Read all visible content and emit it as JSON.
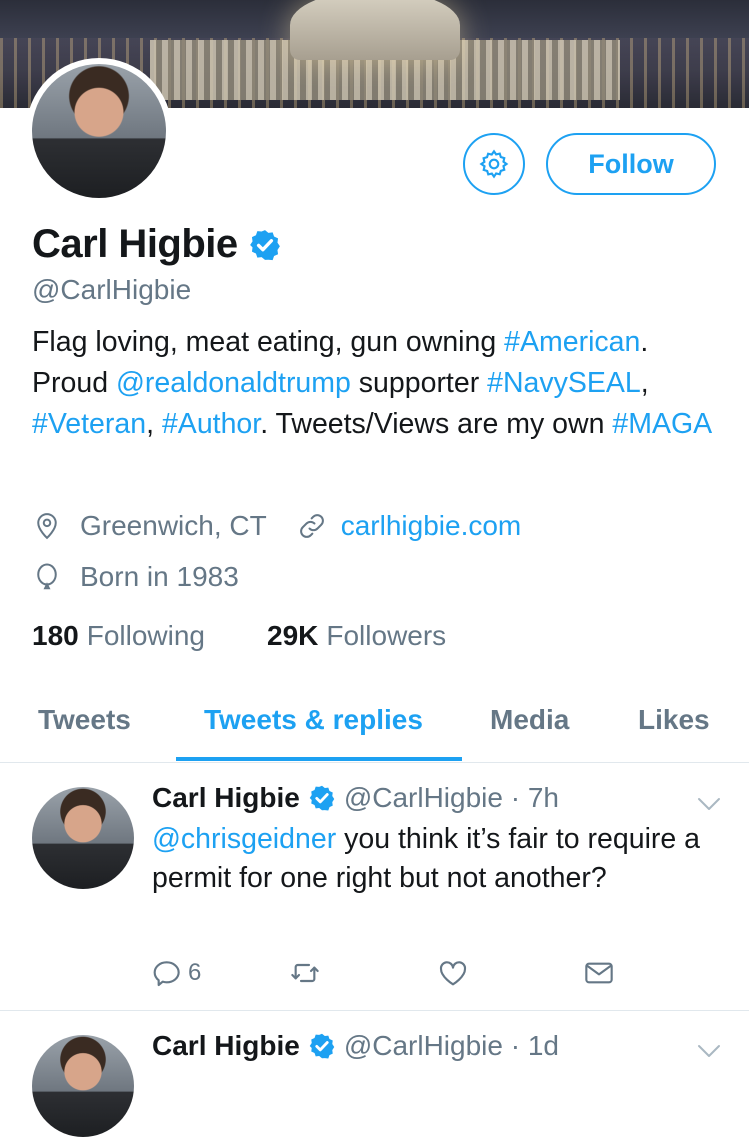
{
  "profile": {
    "name": "Carl Higbie",
    "handle": "@CarlHigbie",
    "follow_label": "Follow",
    "bio": [
      {
        "t": "Flag loving, meat eating, gun owning ",
        "link": false
      },
      {
        "t": "#American",
        "link": true
      },
      {
        "t": ". Proud ",
        "link": false
      },
      {
        "t": "@realdonaldtrump",
        "link": true
      },
      {
        "t": " supporter ",
        "link": false
      },
      {
        "t": "#NavySEAL",
        "link": true
      },
      {
        "t": ", ",
        "link": false
      },
      {
        "t": "#Veteran",
        "link": true
      },
      {
        "t": ", ",
        "link": false
      },
      {
        "t": "#Author",
        "link": true
      },
      {
        "t": ". Tweets/Views are my own ",
        "link": false
      },
      {
        "t": "#MAGA",
        "link": true
      }
    ],
    "location": "Greenwich, CT",
    "website": "carlhigbie.com",
    "born": "Born in 1983",
    "following_count": "180",
    "following_label": "Following",
    "followers_count": "29K",
    "followers_label": "Followers"
  },
  "tabs": {
    "tweets": "Tweets",
    "replies": "Tweets & replies",
    "media": "Media",
    "likes": "Likes",
    "active": "Tweets & replies"
  },
  "tweets": [
    {
      "name": "Carl Higbie",
      "handle": "@CarlHigbie",
      "time": "7h",
      "mention": "@chrisgeidner",
      "text": " you think it’s fair to require a permit for one right but not another?",
      "reply_count": "6"
    },
    {
      "name": "Carl Higbie",
      "handle": "@CarlHigbie",
      "time": "1d"
    }
  ],
  "colors": {
    "accent": "#1da1f2",
    "muted": "#657786",
    "text": "#14171a",
    "border": "#e1e8ed"
  },
  "icons": {
    "settings": "gear-icon",
    "verified": "verified-badge-icon",
    "location": "location-pin-icon",
    "website": "link-icon",
    "born": "balloon-icon",
    "reply": "reply-icon",
    "retweet": "retweet-icon",
    "like": "heart-icon",
    "dm": "envelope-icon",
    "menu": "chevron-down-icon"
  }
}
